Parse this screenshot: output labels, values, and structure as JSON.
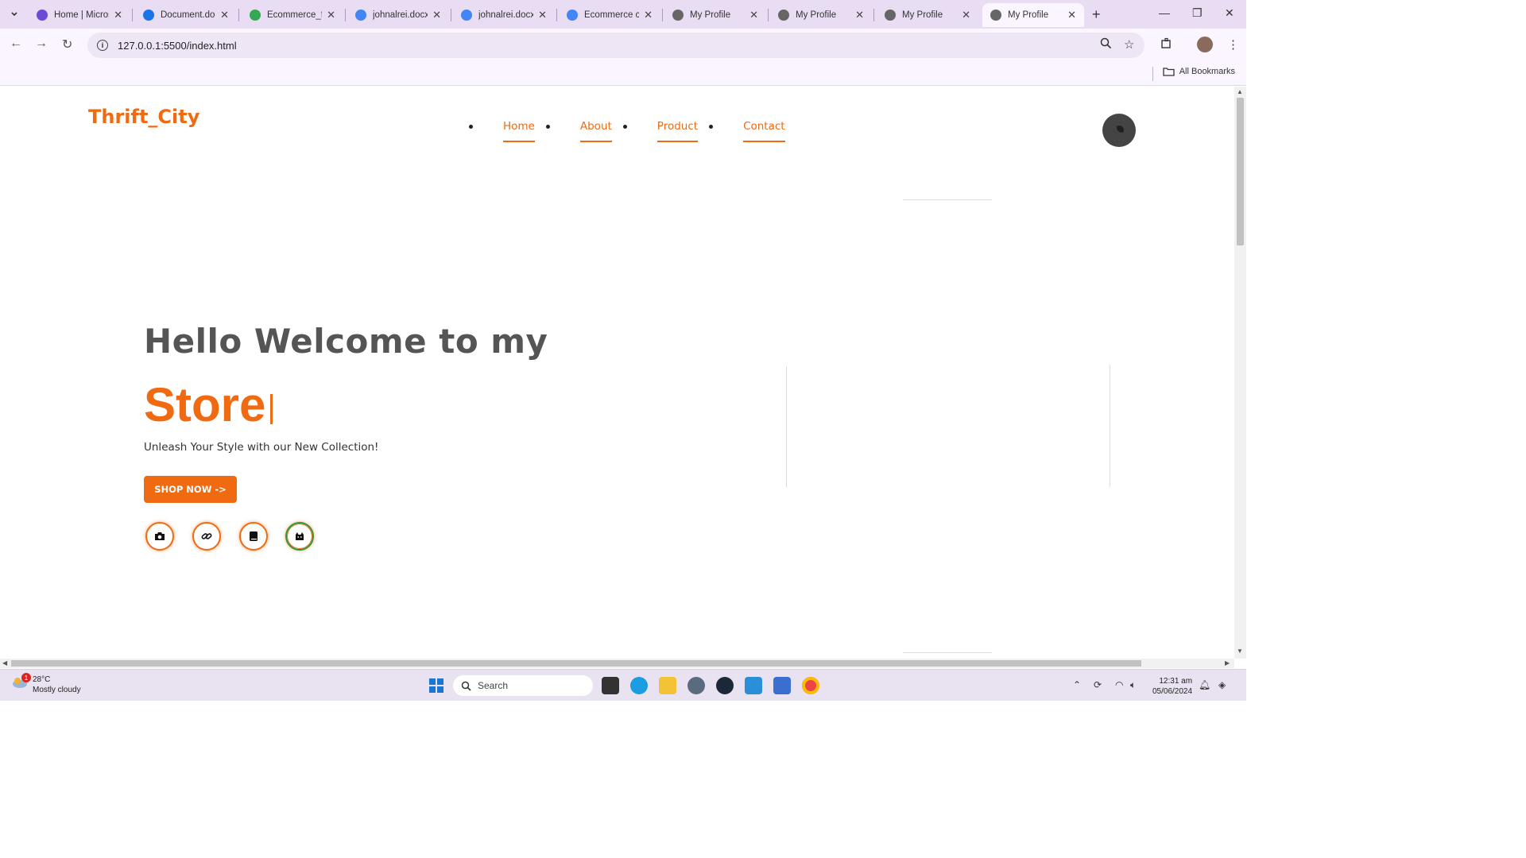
{
  "browser": {
    "tabs": [
      {
        "title": "Home | Micros",
        "favicon_color": "#6b4ad6"
      },
      {
        "title": "Document.doc",
        "favicon_color": "#1a73e8"
      },
      {
        "title": "Ecommerce_fi",
        "favicon_color": "#34a853"
      },
      {
        "title": "johnalrei.docx",
        "favicon_color": "#4285f4"
      },
      {
        "title": "johnalrei.docx",
        "favicon_color": "#4285f4"
      },
      {
        "title": "Ecommerce cc",
        "favicon_color": "#4285f4"
      },
      {
        "title": "My Profile",
        "favicon_color": "#666666"
      },
      {
        "title": "My Profile",
        "favicon_color": "#666666"
      },
      {
        "title": "My Profile",
        "favicon_color": "#666666"
      },
      {
        "title": "My Profile",
        "favicon_color": "#666666",
        "active": true
      }
    ],
    "url": "127.0.0.1:5500/index.html",
    "bookmarks_label": "All Bookmarks"
  },
  "site": {
    "logo": "Thrift_City",
    "nav": [
      "Home",
      "About",
      "Product",
      "Contact"
    ],
    "accent_color": "#f06a12",
    "hero": {
      "heading": "Hello Welcome to my",
      "typed_word": "Store",
      "subtitle": "Unleash Your Style with our New Collection!",
      "cta": "SHOP NOW ->"
    },
    "social_icons": [
      "camera-icon",
      "link-icon",
      "book-icon",
      "cat-icon"
    ]
  },
  "taskbar": {
    "weather_temp": "28°C",
    "weather_desc": "Mostly cloudy",
    "weather_badge": "1",
    "search_placeholder": "Search",
    "time": "12:31 am",
    "date": "05/06/2024"
  }
}
